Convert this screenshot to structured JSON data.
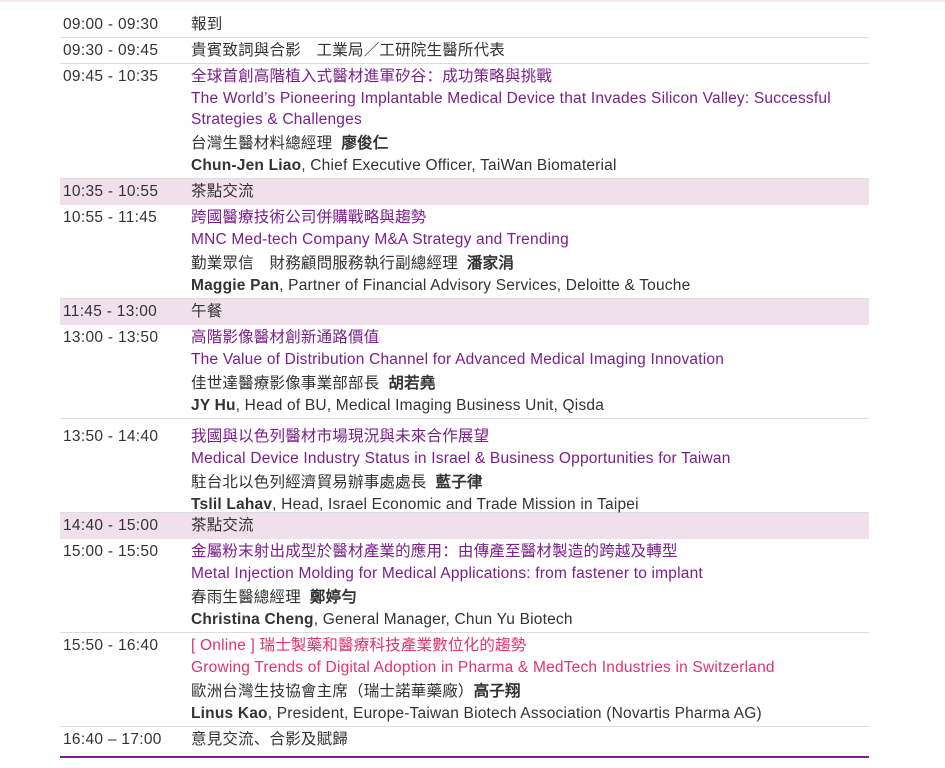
{
  "agenda": [
    {
      "time": "09:00 - 09:30",
      "text": "報到",
      "type": "plain"
    },
    {
      "time": "09:30 - 09:45",
      "text": "貴賓致詞與合影　工業局／工研院生醫所代表",
      "type": "plain"
    },
    {
      "time": "09:45 - 10:35",
      "type": "talk",
      "zh_title": "全球首創高階植入式醫材進軍矽谷：成功策略與挑戰",
      "en_title": "The World’s Pioneering Implantable Medical Device that Invades Silicon Valley: Successful Strategies & Challenges",
      "speaker_zh_role": "台灣生醫材料總經理",
      "speaker_zh_name": "廖俊仁",
      "speaker_en_name": "Chun-Jen Liao",
      "speaker_en_role": ", Chief Executive Officer, TaiWan Biomaterial"
    },
    {
      "time": "10:35 - 10:55",
      "text": "茶點交流",
      "type": "break"
    },
    {
      "time": "10:55 - 11:45",
      "type": "talk",
      "zh_title": "跨國醫療技術公司併購戰略與趨勢",
      "en_title": "MNC Med-tech Company M&A Strategy and Trending",
      "speaker_zh_role": "勤業眾信　財務顧問服務執行副總經理",
      "speaker_zh_name": "潘家涓",
      "speaker_en_name": "Maggie Pan",
      "speaker_en_role": ", Partner of Financial Advisory Services, Deloitte & Touche"
    },
    {
      "time": "11:45 - 13:00",
      "text": "午餐",
      "type": "break"
    },
    {
      "time": "13:00 - 13:50",
      "type": "talk",
      "zh_title": "高階影像醫材創新通路價值",
      "en_title": "The Value of Distribution Channel for Advanced Medical Imaging Innovation",
      "speaker_zh_role": "佳世達醫療影像事業部部長",
      "speaker_zh_name": "胡若堯",
      "speaker_en_name": "JY Hu",
      "speaker_en_role": ", Head of BU, Medical Imaging Business Unit, Qisda"
    },
    {
      "time": "13:50 - 14:40",
      "type": "talk",
      "zh_title": "我國與以色列醫材市場現況與未來合作展望",
      "en_title": "Medical Device Industry Status in Israel & Business Opportunities for Taiwan",
      "speaker_zh_role": "駐台北以色列經濟貿易辦事處處長",
      "speaker_zh_name": "藍子律",
      "speaker_en_name": "Tslil Lahav",
      "speaker_en_role": ", Head, Israel Economic and Trade Mission in Taipei"
    },
    {
      "time": "14:40 - 15:00",
      "text": "茶點交流",
      "type": "break"
    },
    {
      "time": "15:00 - 15:50",
      "type": "talk",
      "zh_title": "金屬粉末射出成型於醫材產業的應用：由傳產至醫材製造的跨越及轉型",
      "en_title": "Metal Injection Molding for Medical Applications: from fastener to implant",
      "speaker_zh_role": "春雨生醫總經理",
      "speaker_zh_name": "鄭婷勻",
      "speaker_en_name": "Christina Cheng",
      "speaker_en_role": ", General Manager, Chun Yu Biotech"
    },
    {
      "time": "15:50 - 16:40",
      "type": "talk",
      "online": true,
      "zh_title": "[ Online ] 瑞士製藥和醫療科技產業數位化的趨勢",
      "en_title": "Growing Trends of Digital Adoption in Pharma & MedTech Industries in Switzerland",
      "speaker_zh_role": "歐洲台灣生技協會主席（瑞士諾華藥廠）",
      "speaker_zh_name": "高子翔",
      "speaker_en_name": "Linus Kao",
      "speaker_en_role": ", President, Europe-Taiwan Biotech Association (Novartis Pharma AG)"
    },
    {
      "time": "16:40 – 17:00",
      "text": "意見交流、合影及賦歸",
      "type": "plain"
    }
  ]
}
